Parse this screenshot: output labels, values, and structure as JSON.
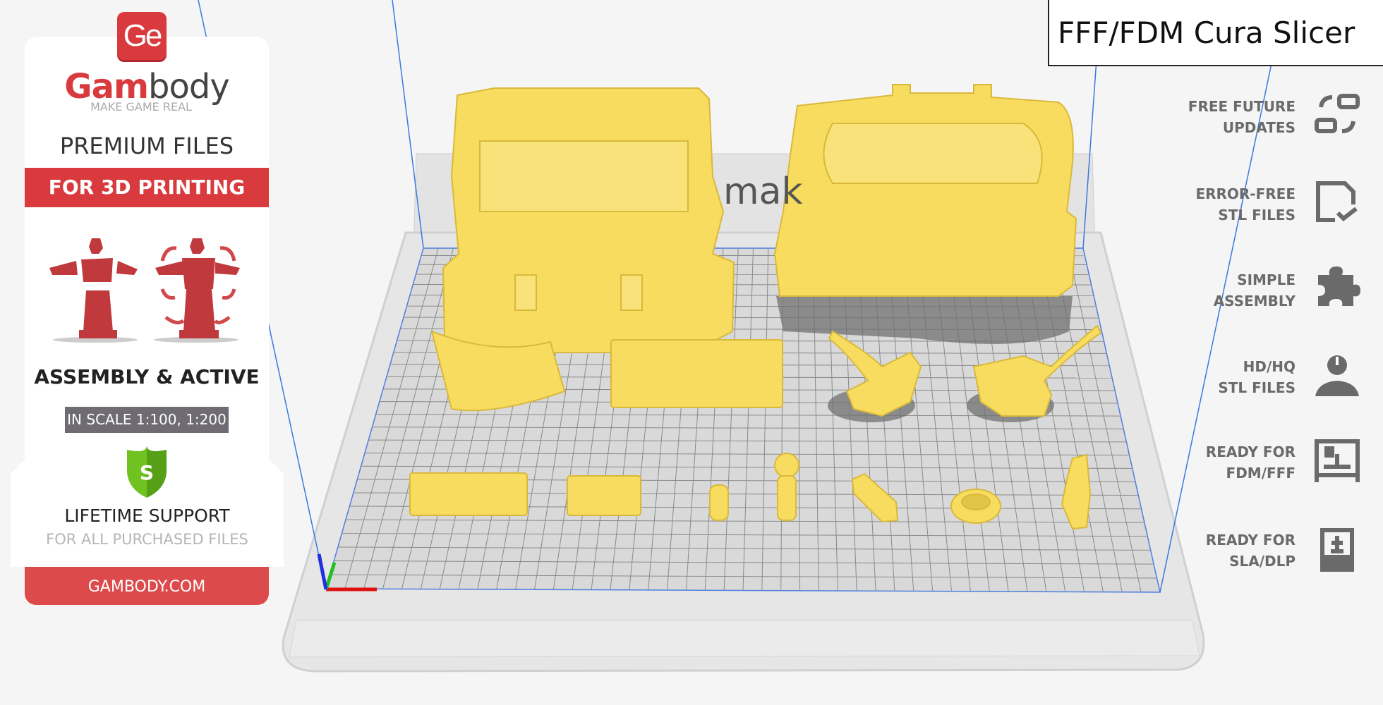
{
  "header": {
    "title": "FFF/FDM Cura Slicer"
  },
  "viewport": {
    "plate_watermark": "mak",
    "model_color": "#f7dc5f",
    "grid_color": "#8a8a8a",
    "axis_colors": {
      "x": "#e01010",
      "y": "#20c020",
      "z": "#2030e0"
    }
  },
  "promo": {
    "logo_mark": "Ge",
    "brand_part1": "Gam",
    "brand_part2": "body",
    "tagline": "MAKE GAME REAL",
    "premium": "PREMIUM FILES",
    "band": "FOR 3D PRINTING",
    "assembly": "ASSEMBLY & ACTIVE",
    "scale": "IN SCALE 1:100, 1:200",
    "shield_letter": "S",
    "support_title": "LIFETIME SUPPORT",
    "support_sub": "FOR ALL PURCHASED FILES",
    "website": "GAMBODY.COM",
    "brand_color": "#d93a3d"
  },
  "features": [
    {
      "line1": "FREE FUTURE",
      "line2": "UPDATES",
      "icon": "swap-icon"
    },
    {
      "line1": "ERROR-FREE",
      "line2": "STL FILES",
      "icon": "file-check-icon"
    },
    {
      "line1": "SIMPLE",
      "line2": "ASSEMBLY",
      "icon": "puzzle-icon"
    },
    {
      "line1": "HD/HQ",
      "line2": "STL FILES",
      "icon": "bust-icon"
    },
    {
      "line1": "READY FOR",
      "line2": "FDM/FFF",
      "icon": "fdm-printer-icon"
    },
    {
      "line1": "READY FOR",
      "line2": "SLA/DLP",
      "icon": "sla-printer-icon"
    }
  ]
}
